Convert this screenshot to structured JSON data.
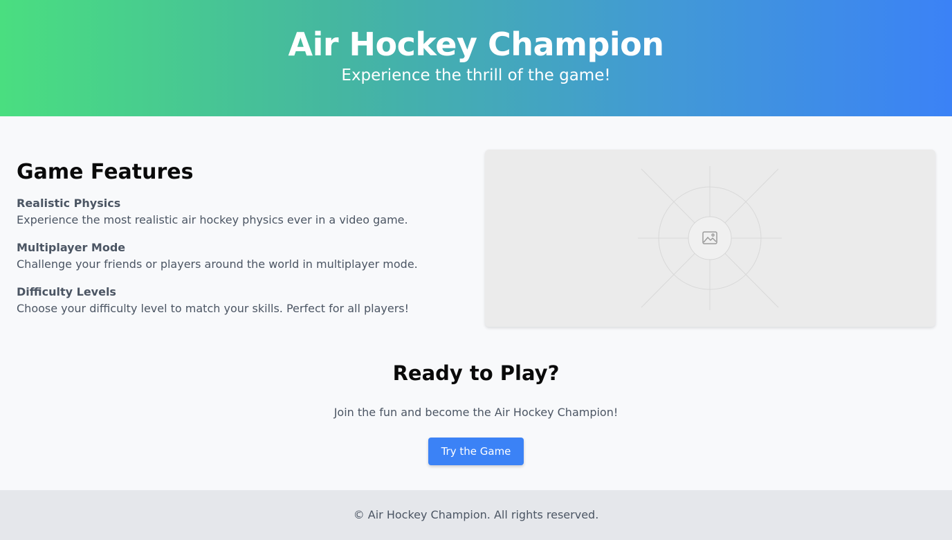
{
  "hero": {
    "title": "Air Hockey Champion",
    "subtitle": "Experience the thrill of the game!"
  },
  "features": {
    "heading": "Game Features",
    "items": [
      {
        "title": "Realistic Physics",
        "description": "Experience the most realistic air hockey physics ever in a video game."
      },
      {
        "title": "Multiplayer Mode",
        "description": "Challenge your friends or players around the world in multiplayer mode."
      },
      {
        "title": "Difficulty Levels",
        "description": "Choose your difficulty level to match your skills. Perfect for all players!"
      }
    ]
  },
  "image_placeholder": {
    "icon": "image-icon"
  },
  "cta": {
    "heading": "Ready to Play?",
    "text": "Join the fun and become the Air Hockey Champion!",
    "button_label": "Try the Game"
  },
  "footer": {
    "text": "© Air Hockey Champion. All rights reserved."
  },
  "colors": {
    "gradient_start": "#4ade80",
    "gradient_end": "#3b82f6",
    "button": "#3b82f6",
    "footer_bg": "#e5e7eb"
  }
}
